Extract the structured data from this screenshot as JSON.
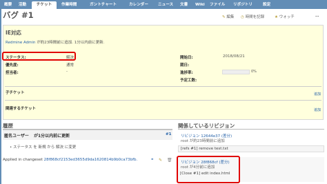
{
  "tabs": [
    "概要",
    "活動",
    "チケット",
    "作業時間",
    "ガントチャート",
    "カレンダー",
    "ニュース",
    "文書",
    "Wiki",
    "ファイル",
    "リポジトリ",
    "設定"
  ],
  "active_tab_index": 2,
  "issue_title": "バグ #1",
  "actions": {
    "edit": "編集",
    "log_time": "時間を記録",
    "watch": "ウォッチ",
    "more": "…"
  },
  "issue": {
    "subject": "IE対応",
    "author_link": "Redmine Admin",
    "author_text": " が約23時間前に追加. 1分以内前に更新.",
    "fields_left": [
      {
        "label": "ステータス:",
        "value": "解決"
      },
      {
        "label": "優先度:",
        "value": "通常"
      },
      {
        "label": "担当者:",
        "value": "-"
      }
    ],
    "fields_right": [
      {
        "label": "開始日:",
        "value": "2018/08/21"
      },
      {
        "label": "期日:",
        "value": ""
      },
      {
        "label": "進捗率:",
        "value": "0%"
      },
      {
        "label": "予定工数:",
        "value": ""
      }
    ],
    "progress_percent": 0,
    "subtasks_label": "子チケット",
    "related_label": "関連するチケット",
    "add_label": "追加"
  },
  "history": {
    "heading": "履歴",
    "entry_author": "匿名ユーザー",
    "entry_time": "が1分以内前に更新",
    "entry_number": "#1",
    "status_change": "ステータス を 新規 から 解決 に変更",
    "changeset_prefix": "Applied in changeset ",
    "changeset_link": "28f868cf2153ed3655d9da1620814b9b0ca73bfb."
  },
  "revisions": {
    "heading": "関係しているリビジョン",
    "items": [
      {
        "link": "リビジョン 12644e37 (差分)",
        "meta": "root が約23時間前に追加",
        "message": "[refs #1] remove test.txt"
      },
      {
        "link": "リビジョン 28f868cf (差分)",
        "meta": "root が4分前に追加",
        "message": "[Close #1] edit index.html"
      }
    ]
  }
}
